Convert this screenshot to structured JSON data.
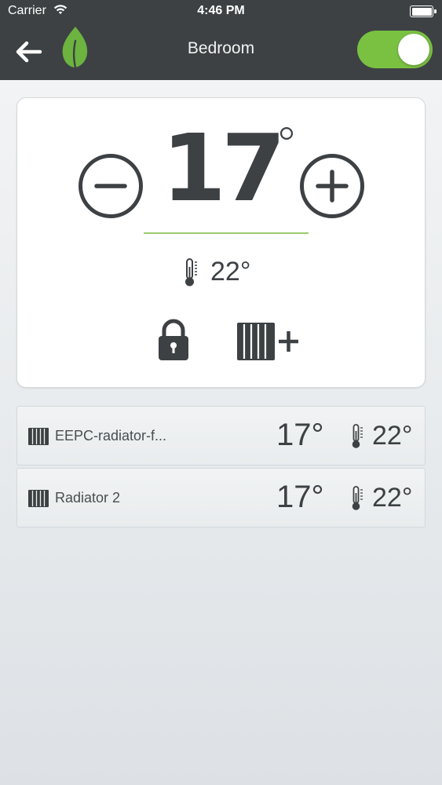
{
  "status_bar": {
    "carrier": "Carrier",
    "time": "4:46 PM",
    "wifi_icon": "wifi-icon",
    "battery_icon": "battery-icon"
  },
  "header": {
    "title": "Bedroom",
    "back_icon": "arrow-left-icon",
    "logo_icon": "leaf-icon",
    "toggle_on": true,
    "background_color": "#3d4144",
    "accent_color": "#7ac142"
  },
  "thermostat": {
    "setpoint": "17",
    "setpoint_unit": "°",
    "current_temperature": "22°",
    "decrease_icon": "minus-circle-icon",
    "increase_icon": "plus-circle-icon",
    "thermometer_icon": "thermometer-icon",
    "lock_icon": "lock-icon",
    "add_radiator_icon": "radiator-plus-icon"
  },
  "devices": [
    {
      "name": "EEPC-radiator-f...",
      "setpoint": "17°",
      "current": "22°",
      "icon": "radiator-icon"
    },
    {
      "name": "Radiator 2",
      "setpoint": "17°",
      "current": "22°",
      "icon": "radiator-icon"
    }
  ]
}
